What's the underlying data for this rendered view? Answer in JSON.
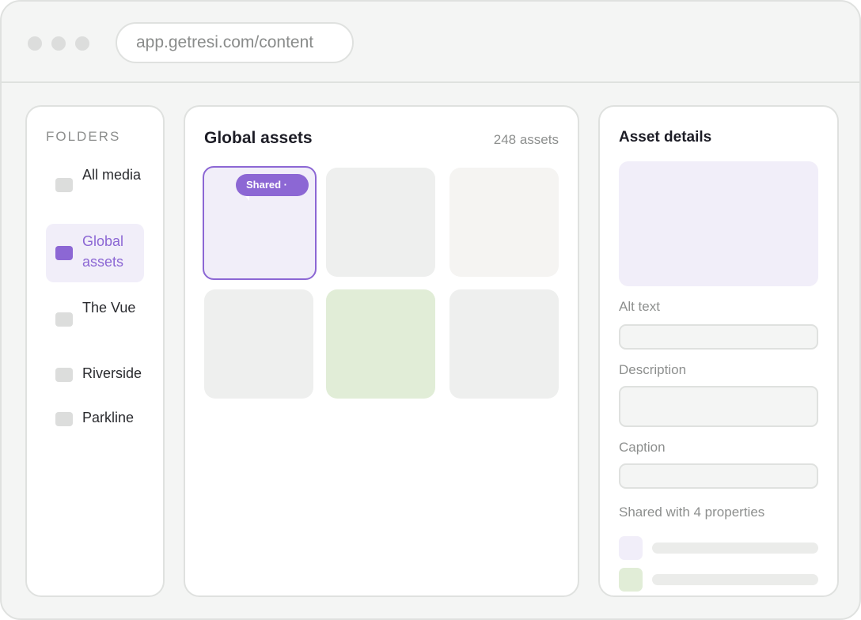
{
  "browser": {
    "url": "app.getresi.com/content"
  },
  "sidebar": {
    "title": "FOLDERS",
    "items": [
      {
        "label": "All media",
        "active": false
      },
      {
        "label": "Global assets",
        "active": true
      },
      {
        "label": "The Vue",
        "active": false
      },
      {
        "label": "Riverside",
        "active": false
      },
      {
        "label": "Parkline",
        "active": false
      }
    ]
  },
  "main": {
    "title": "Global assets",
    "count": "248 assets",
    "tiles": [
      {
        "color": "#f1eef9",
        "selected": true,
        "badge": "Shared ·"
      },
      {
        "color": "#eeefee",
        "selected": false
      },
      {
        "color": "#f5f4f2",
        "selected": false
      },
      {
        "color": "#eeefee",
        "selected": false
      },
      {
        "color": "#e1edd7",
        "selected": false
      },
      {
        "color": "#eeefee",
        "selected": false
      }
    ]
  },
  "details": {
    "title": "Asset details",
    "alt_text_label": "Alt text",
    "description_label": "Description",
    "caption_label": "Caption",
    "shared_label": "Shared with 4 properties",
    "property_colors": [
      "#f1eef9",
      "#e1edd7",
      "#fbf1ee"
    ]
  },
  "colors": {
    "accent": "#8c67d4",
    "accent_light": "#f1eef9",
    "border": "#dfe1df"
  }
}
